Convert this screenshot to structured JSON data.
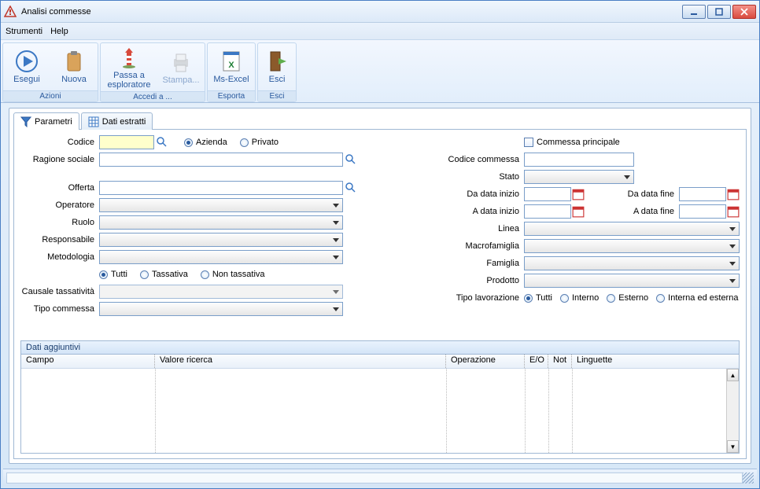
{
  "window": {
    "title": "Analisi commesse"
  },
  "menu": {
    "tools": "Strumenti",
    "help": "Help"
  },
  "ribbon": {
    "azioni": {
      "label": "Azioni",
      "esegui": "Esegui",
      "nuova": "Nuova"
    },
    "accedi": {
      "label": "Accedi a ...",
      "passa": "Passa a esploratore",
      "stampa": "Stampa..."
    },
    "esporta": {
      "label": "Esporta",
      "excel": "Ms-Excel"
    },
    "esci": {
      "label": "Esci",
      "esci_btn": "Esci"
    }
  },
  "tabs": {
    "parametri": "Parametri",
    "dati_estratti": "Dati estratti"
  },
  "form": {
    "codice": "Codice",
    "azienda": "Azienda",
    "privato": "Privato",
    "ragione_sociale": "Ragione sociale",
    "offerta": "Offerta",
    "operatore": "Operatore",
    "ruolo": "Ruolo",
    "responsabile": "Responsabile",
    "metodologia": "Metodologia",
    "tutti": "Tutti",
    "tassativa": "Tassativa",
    "non_tassativa": "Non tassativa",
    "causale_tassativita": "Causale tassatività",
    "tipo_commessa": "Tipo commessa",
    "commessa_principale": "Commessa principale",
    "codice_commessa": "Codice commessa",
    "stato": "Stato",
    "da_data_inizio": "Da data inizio",
    "da_data_fine": "Da data fine",
    "a_data_inizio": "A data inizio",
    "a_data_fine": "A data fine",
    "linea": "Linea",
    "macrofamiglia": "Macrofamiglia",
    "famiglia": "Famiglia",
    "prodotto": "Prodotto",
    "tipo_lavorazione": "Tipo lavorazione",
    "interno": "Interno",
    "esterno": "Esterno",
    "interna_esterna": "Interna ed esterna"
  },
  "grid": {
    "title": "Dati aggiuntivi",
    "cols": {
      "campo": "Campo",
      "valore": "Valore ricerca",
      "operazione": "Operazione",
      "eo": "E/O",
      "not": "Not",
      "linguette": "Linguette"
    }
  }
}
